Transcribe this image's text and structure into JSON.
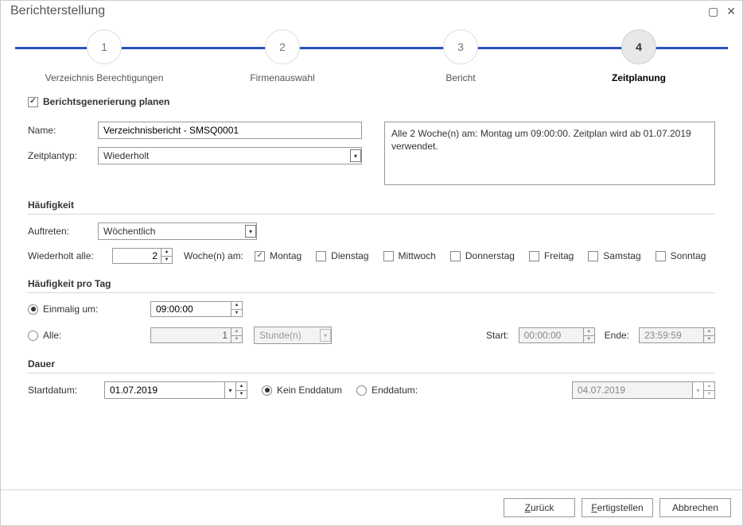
{
  "titlebar": {
    "title": "Berichterstellung"
  },
  "wizard": {
    "steps": [
      {
        "num": "1",
        "label": "Verzeichnis Berechtigungen"
      },
      {
        "num": "2",
        "label": "Firmenauswahl"
      },
      {
        "num": "3",
        "label": "Bericht"
      },
      {
        "num": "4",
        "label": "Zeitplanung"
      }
    ],
    "active_index": 3
  },
  "plan": {
    "checkbox_label": "Berichtsgenerierung planen",
    "name_label": "Name:",
    "name_value": "Verzeichnisbericht - SMSQ0001",
    "type_label": "Zeitplantyp:",
    "type_value": "Wiederholt",
    "summary": "Alle 2 Woche(n) am: Montag um 09:00:00. Zeitplan wird ab 01.07.2019 verwendet."
  },
  "freq": {
    "title": "Häufigkeit",
    "occur_label": "Auftreten:",
    "occur_value": "Wöchentlich",
    "repeat_label": "Wiederholt alle:",
    "repeat_value": "2",
    "repeat_unit": "Woche(n) am:",
    "days": [
      {
        "label": "Montag",
        "checked": true
      },
      {
        "label": "Dienstag",
        "checked": false
      },
      {
        "label": "Mittwoch",
        "checked": false
      },
      {
        "label": "Donnerstag",
        "checked": false
      },
      {
        "label": "Freitag",
        "checked": false
      },
      {
        "label": "Samstag",
        "checked": false
      },
      {
        "label": "Sonntag",
        "checked": false
      }
    ]
  },
  "daily": {
    "title": "Häufigkeit pro Tag",
    "once_label": "Einmalig um:",
    "once_value": "09:00:00",
    "every_label": "Alle:",
    "every_value": "1",
    "every_unit": "Stunde(n)",
    "start_label": "Start:",
    "start_value": "00:00:00",
    "end_label": "Ende:",
    "end_value": "23:59:59"
  },
  "duration": {
    "title": "Dauer",
    "start_label": "Startdatum:",
    "start_value": "01.07.2019",
    "noend_label": "Kein Enddatum",
    "end_label": "Enddatum:",
    "end_value": "04.07.2019"
  },
  "footer": {
    "back": "Zurück",
    "finish": "Fertigstellen",
    "cancel": "Abbrechen"
  }
}
